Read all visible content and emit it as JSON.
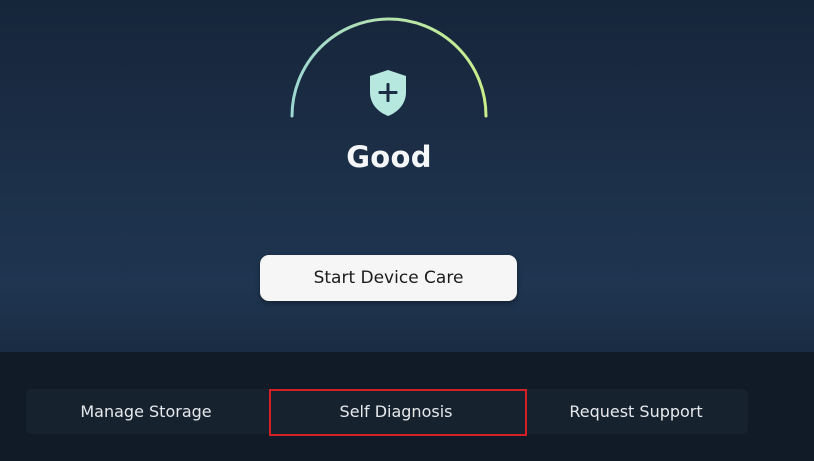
{
  "device_care": {
    "status": "Good",
    "start_button_label": "Start Device Care",
    "icon": "shield-plus-icon",
    "colors": {
      "gauge_arc_start": "#9ed8d2",
      "gauge_arc_end": "#c9ee8a",
      "shield_fill": "#b6e8e0",
      "focus_outline": "#d41f26"
    }
  },
  "bottom_menu": {
    "items": [
      {
        "label": "Manage Storage",
        "focused": false
      },
      {
        "label": "Self Diagnosis",
        "focused": true
      },
      {
        "label": "Request Support",
        "focused": false
      }
    ]
  }
}
